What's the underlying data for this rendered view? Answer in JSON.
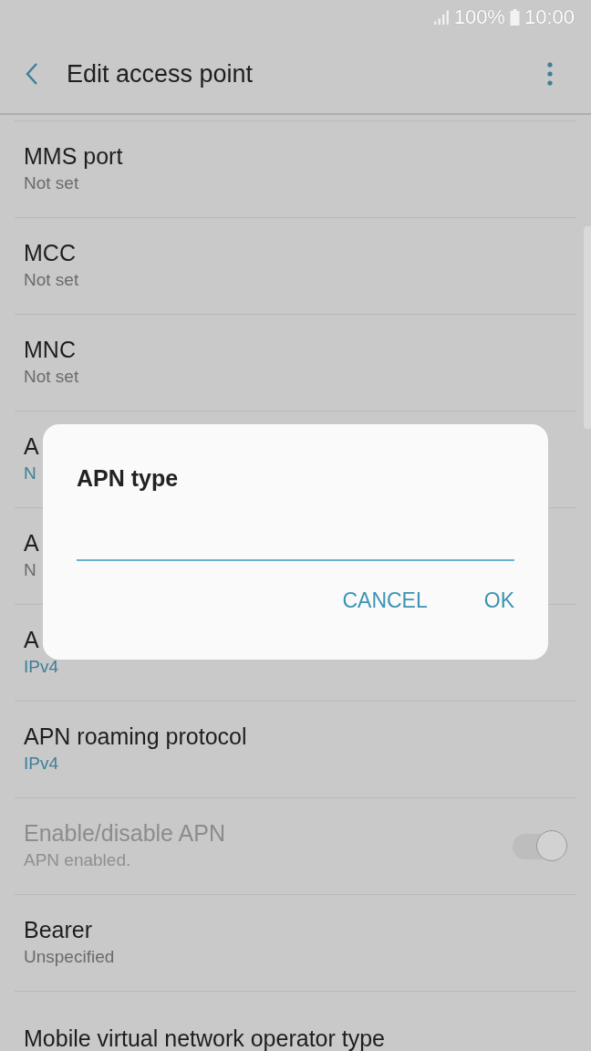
{
  "status_bar": {
    "battery": "100%",
    "time": "10:00"
  },
  "toolbar": {
    "title": "Edit access point"
  },
  "settings": [
    {
      "kind": "text",
      "title": "MMS port",
      "value": "Not set",
      "accent": false,
      "disabled": false
    },
    {
      "kind": "text",
      "title": "MCC",
      "value": "Not set",
      "accent": false,
      "disabled": false
    },
    {
      "kind": "text",
      "title": "MNC",
      "value": "Not set",
      "accent": false,
      "disabled": false
    },
    {
      "kind": "text",
      "title": "A",
      "value": "N",
      "accent": true,
      "disabled": false
    },
    {
      "kind": "text",
      "title": "A",
      "value": "N",
      "accent": false,
      "disabled": false
    },
    {
      "kind": "text",
      "title": "A",
      "value": "IPv4",
      "accent": true,
      "disabled": false
    },
    {
      "kind": "text",
      "title": "APN roaming protocol",
      "value": "IPv4",
      "accent": true,
      "disabled": false
    },
    {
      "kind": "switch",
      "title": "Enable/disable APN",
      "value": "APN enabled.",
      "disabled": true,
      "on": true
    },
    {
      "kind": "text",
      "title": "Bearer",
      "value": "Unspecified",
      "accent": false,
      "disabled": false
    },
    {
      "kind": "text",
      "title": "Mobile virtual network operator type",
      "disabled": false
    }
  ],
  "dialog": {
    "title": "APN type",
    "buttons": [
      "CANCEL",
      "OK"
    ]
  }
}
